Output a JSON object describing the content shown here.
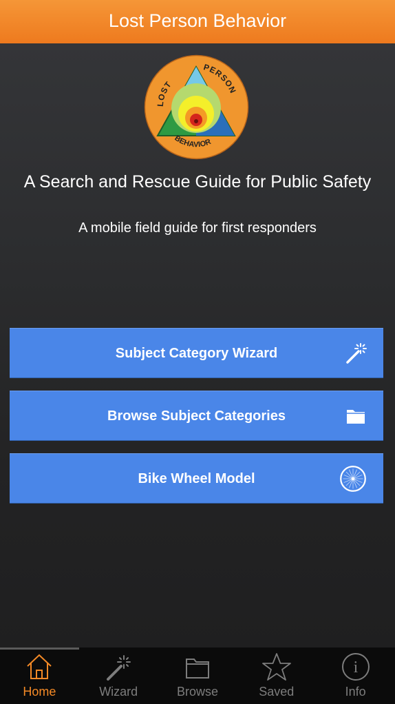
{
  "header": {
    "title": "Lost Person Behavior"
  },
  "logo": {
    "top_text": "LOST",
    "right_text": "PERSON",
    "bottom_text": "BEHAVIOR"
  },
  "main": {
    "headline": "A Search and Rescue Guide for Public Safety",
    "subline": "A mobile field guide for first responders"
  },
  "buttons": [
    {
      "label": "Subject Category Wizard",
      "icon": "magic-wand-icon"
    },
    {
      "label": "Browse Subject Categories",
      "icon": "folder-icon"
    },
    {
      "label": "Bike Wheel Model",
      "icon": "bike-wheel-icon"
    }
  ],
  "tabs": [
    {
      "label": "Home",
      "icon": "home-icon",
      "active": true
    },
    {
      "label": "Wizard",
      "icon": "magic-wand-icon",
      "active": false
    },
    {
      "label": "Browse",
      "icon": "folder-icon",
      "active": false
    },
    {
      "label": "Saved",
      "icon": "star-icon",
      "active": false
    },
    {
      "label": "Info",
      "icon": "info-icon",
      "active": false
    }
  ],
  "colors": {
    "accent": "#f58a26",
    "button": "#4a86e8",
    "tab_inactive": "#7d7d7d"
  }
}
